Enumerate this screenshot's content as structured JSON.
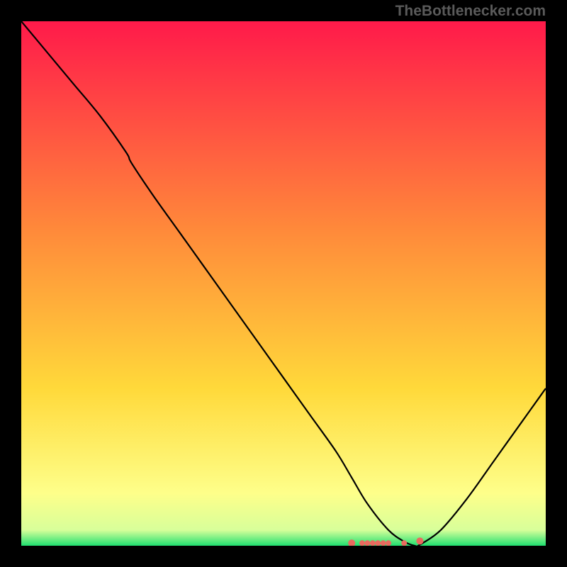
{
  "watermark": "TheBottlenecker.com",
  "chart_data": {
    "type": "line",
    "title": "",
    "xlabel": "",
    "ylabel": "",
    "xlim": [
      0,
      100
    ],
    "ylim": [
      0,
      100
    ],
    "gradient_stops": [
      {
        "offset": 0,
        "color": "#ff1a4a"
      },
      {
        "offset": 40,
        "color": "#ff8a3a"
      },
      {
        "offset": 70,
        "color": "#ffd93a"
      },
      {
        "offset": 90,
        "color": "#feff8a"
      },
      {
        "offset": 97,
        "color": "#d8ff9a"
      },
      {
        "offset": 100,
        "color": "#20e070"
      }
    ],
    "series": [
      {
        "name": "bottleneck-curve",
        "x": [
          0,
          5,
          10,
          15,
          20,
          21,
          25,
          30,
          35,
          40,
          45,
          50,
          55,
          60,
          63,
          66,
          70,
          73,
          75,
          76,
          80,
          85,
          90,
          95,
          100
        ],
        "y": [
          100,
          94,
          88,
          82,
          75,
          73,
          67,
          60,
          53,
          46,
          39,
          32,
          25,
          18,
          13,
          8,
          3,
          0.8,
          0,
          0.2,
          3,
          9,
          16,
          23,
          30
        ]
      }
    ],
    "markers": {
      "name": "highlight-points",
      "x": [
        63,
        65,
        66,
        67,
        68,
        69,
        70,
        73,
        76
      ],
      "y": [
        0.5,
        0.5,
        0.5,
        0.5,
        0.5,
        0.5,
        0.5,
        0.5,
        0.9
      ],
      "color": "#e96a5f"
    }
  }
}
